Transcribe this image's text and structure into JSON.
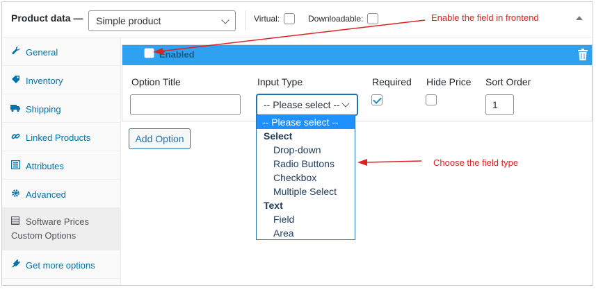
{
  "header": {
    "title": "Product data —",
    "product_type": "Simple product",
    "virtual_label": "Virtual:",
    "downloadable_label": "Downloadable:"
  },
  "sidebar": {
    "items": [
      {
        "label": "General",
        "icon": "wrench-icon"
      },
      {
        "label": "Inventory",
        "icon": "tag-icon"
      },
      {
        "label": "Shipping",
        "icon": "truck-icon"
      },
      {
        "label": "Linked Products",
        "icon": "link-icon"
      },
      {
        "label": "Attributes",
        "icon": "list-icon"
      },
      {
        "label": "Advanced",
        "icon": "gear-icon"
      },
      {
        "label_line1": "Software Prices",
        "label_line2": "Custom Options",
        "icon": "table-icon"
      },
      {
        "label": "Get more options",
        "icon": "plugin-icon"
      }
    ]
  },
  "option": {
    "enabled_label": "Enabled",
    "columns": {
      "title": "Option Title",
      "input_type": "Input Type",
      "required": "Required",
      "hide_price": "Hide Price",
      "sort_order": "Sort Order"
    },
    "title_value": "",
    "input_type_value": "-- Please select --",
    "required_checked": true,
    "hide_price_checked": false,
    "sort_order_value": "1"
  },
  "add_option_label": "Add Option",
  "dropdown": {
    "items": [
      {
        "kind": "sel",
        "label": "-- Please select --"
      },
      {
        "kind": "grp",
        "label": "Select"
      },
      {
        "kind": "opt",
        "label": "Drop-down"
      },
      {
        "kind": "opt",
        "label": "Radio Buttons"
      },
      {
        "kind": "opt",
        "label": "Checkbox"
      },
      {
        "kind": "opt",
        "label": "Multiple Select"
      },
      {
        "kind": "grp",
        "label": "Text"
      },
      {
        "kind": "opt",
        "label": "Field"
      },
      {
        "kind": "opt",
        "label": "Area"
      }
    ]
  },
  "annotations": {
    "enable_note": "Enable the field in frontend",
    "type_note": "Choose the field type"
  },
  "colors": {
    "accent": "#2ea2f0",
    "link": "#0073aa",
    "annotation": "#e02020"
  }
}
